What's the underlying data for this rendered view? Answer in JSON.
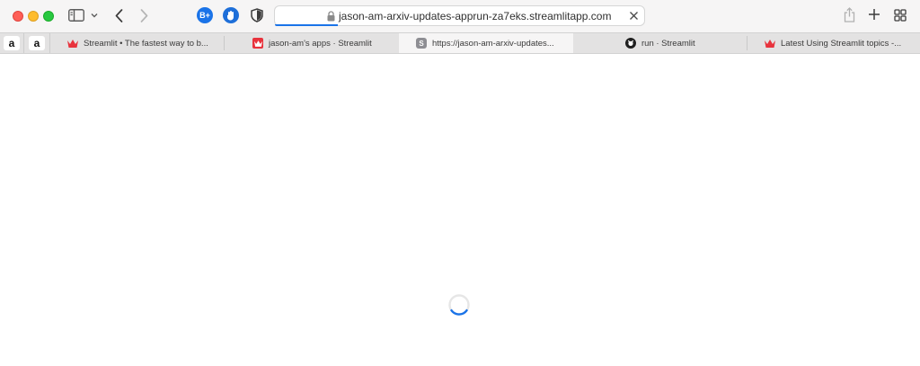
{
  "window": {
    "controls": [
      "close",
      "minimize",
      "maximize"
    ]
  },
  "toolbar": {
    "sidebar_icon": "sidebar-icon",
    "back_icon": "chevron-left-icon",
    "forward_icon": "chevron-right-icon",
    "extensions": [
      {
        "name": "bplus-extension",
        "label": "B+"
      },
      {
        "name": "hand-extension",
        "label": ""
      },
      {
        "name": "shield-extension",
        "label": ""
      }
    ],
    "share_icon": "share-icon",
    "new_tab_icon": "plus-icon",
    "tab_overview_icon": "grid-icon"
  },
  "address_bar": {
    "url": "jason-am-arxiv-updates-apprun-za7eks.streamlitapp.com",
    "secure": true,
    "loading_progress": 0.17
  },
  "pinned_tabs": [
    {
      "label": "a",
      "site": "amazon"
    },
    {
      "label": "a",
      "site": "amazon"
    }
  ],
  "tabs": [
    {
      "title": "Streamlit • The fastest way to b...",
      "favicon": "streamlit-crown",
      "active": false
    },
    {
      "title": "jason-am's apps · Streamlit",
      "favicon": "streamlit-crown-box",
      "active": false
    },
    {
      "title": "https://jason-am-arxiv-updates...",
      "favicon": "S",
      "active": true
    },
    {
      "title": "run · Streamlit",
      "favicon": "github",
      "active": false
    },
    {
      "title": "Latest Using Streamlit topics -...",
      "favicon": "streamlit-crown",
      "active": false
    }
  ],
  "page": {
    "state": "loading",
    "colors": {
      "accent": "#1a73e8",
      "crown": "#e8333d"
    }
  }
}
